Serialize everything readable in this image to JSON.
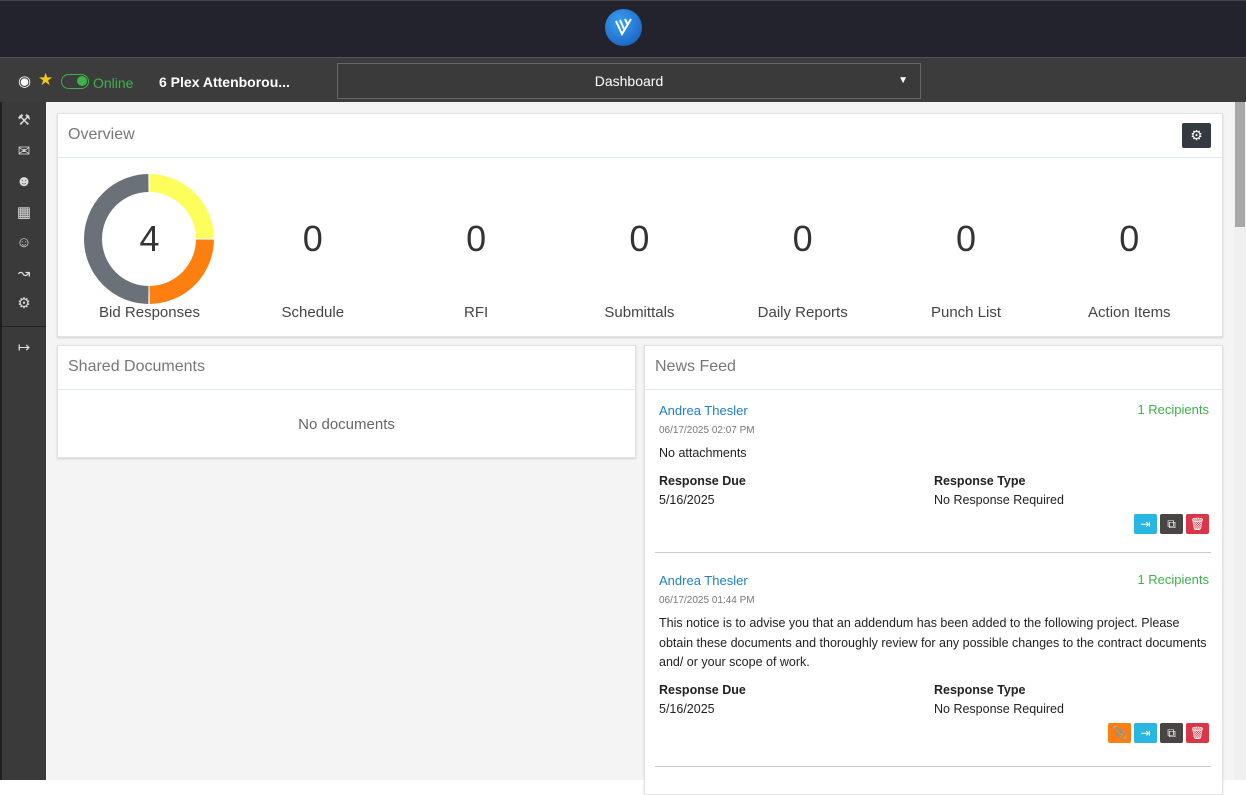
{
  "header": {
    "project": "6 Plex Attenborou...",
    "status": "Online",
    "view_select": "Dashboard"
  },
  "sidebar": {
    "items": [
      "tools",
      "messages",
      "contacts",
      "calendar",
      "user-schedule",
      "reports",
      "settings",
      "logout"
    ]
  },
  "overview": {
    "title": "Overview",
    "stats": [
      {
        "label": "Bid Responses",
        "value": "4",
        "segments": [
          {
            "value": 1,
            "color": "#fdfd5c"
          },
          {
            "value": 1,
            "color": "#fd7f0f"
          },
          {
            "value": 2,
            "color": "#6b7178"
          }
        ]
      },
      {
        "label": "Schedule",
        "value": "0"
      },
      {
        "label": "RFI",
        "value": "0"
      },
      {
        "label": "Submittals",
        "value": "0"
      },
      {
        "label": "Daily Reports",
        "value": "0"
      },
      {
        "label": "Punch List",
        "value": "0"
      },
      {
        "label": "Action Items",
        "value": "0"
      }
    ]
  },
  "shared": {
    "title": "Shared Documents",
    "empty": "No documents"
  },
  "news": {
    "title": "News Feed",
    "items": [
      {
        "author": "Andrea Thesler",
        "recipients": "1 Recipients",
        "time": "06/17/2025 02:07 PM",
        "body": "No attachments",
        "due_label": "Response Due",
        "due": "5/16/2025",
        "type_label": "Response Type",
        "type": "No Response Required"
      },
      {
        "author": "Andrea Thesler",
        "recipients": "1 Recipients",
        "time": "06/17/2025 01:44 PM",
        "body": "This notice is to advise you that an addendum has been added to the following project. Please obtain these documents and thoroughly review for any possible changes to the contract documents and/ or your scope of work.",
        "due_label": "Response Due",
        "due": "5/16/2025",
        "type_label": "Response Type",
        "type": "No Response Required"
      }
    ]
  }
}
